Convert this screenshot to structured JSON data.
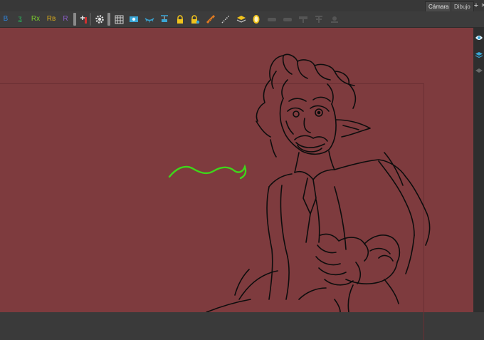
{
  "view_tabs": [
    {
      "label": "Cámara",
      "active": true
    },
    {
      "label": "Dibujo",
      "active": false
    }
  ],
  "window_buttons": {
    "add": "+",
    "close": "✕"
  },
  "toolbar": {
    "text_tools": [
      {
        "label": "Β",
        "color": "#2f82d8",
        "name": "beta-tool"
      },
      {
        "label": "ʓ",
        "color": "#2cae5a",
        "name": "snap-tool"
      },
      {
        "label": "Rx",
        "color": "#79c92e",
        "name": "rx-tool"
      },
      {
        "label": "Rв",
        "color": "#d4a71e",
        "name": "rb-tool"
      },
      {
        "label": "R",
        "color": "#8a5cc7",
        "name": "r-tool"
      }
    ],
    "icons": [
      "pivot-add-icon",
      "gear-icon",
      "grid-icon",
      "onion-skin-icon",
      "eye-closed-icon",
      "align-icon",
      "lock-icon",
      "lock-layer-icon",
      "ruler-icon",
      "dotted-line-icon",
      "stack-icon",
      "light-icon",
      "brush-grey-icon",
      "eraser-grey-icon",
      "stamp-grey-icon",
      "flip-grey-icon",
      "key-grey-icon"
    ]
  },
  "side_panel": {
    "icons": [
      "eye-icon",
      "layers-icon",
      "layers-collapsed-icon"
    ]
  },
  "colors": {
    "canvas": "#7e3b3e",
    "stroke": "#0d0d0d",
    "accent_stroke": "#3fd61a"
  }
}
